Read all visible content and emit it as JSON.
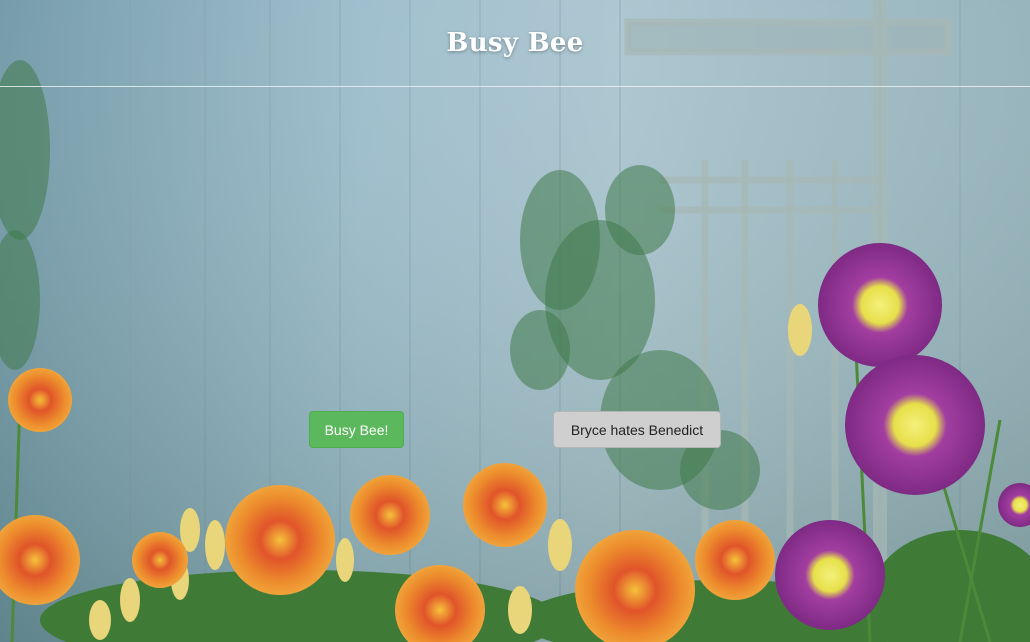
{
  "header": {
    "title": "Busy Bee"
  },
  "buttons": {
    "primary_label": "Busy Bee!",
    "secondary_label": "Bryce hates Benedict"
  },
  "background": {
    "icon": "garden-flowers-photo",
    "colors": {
      "wall": "#8fb0bf",
      "orange_lily": "#e8792a",
      "purple_lily": "#8e2f8f",
      "green_button": "#5cb85c",
      "gray_button": "#cfcfcf"
    }
  }
}
